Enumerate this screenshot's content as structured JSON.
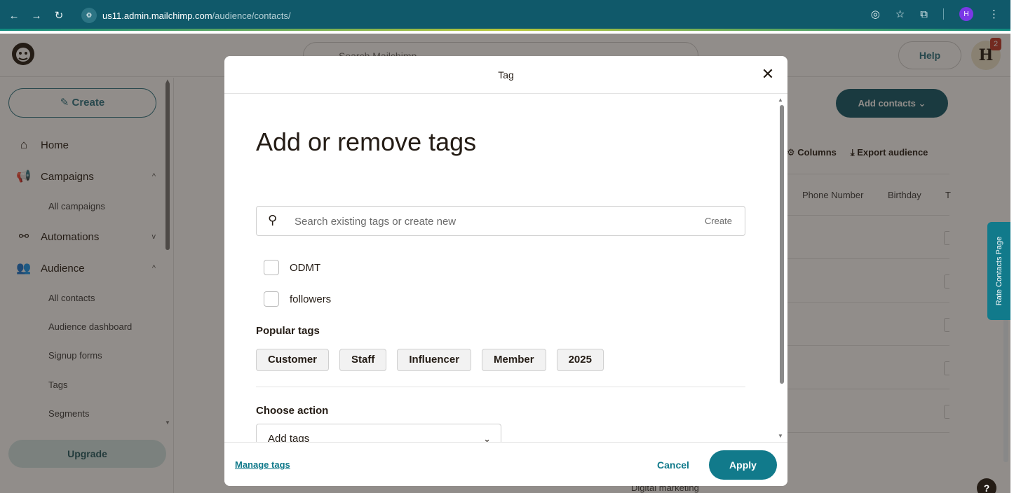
{
  "browser": {
    "url_host": "us11.admin.mailchimp.com",
    "url_path": "/audience/contacts/",
    "profile_initial": "H"
  },
  "header": {
    "search_placeholder": "Search Mailchimp",
    "help_label": "Help",
    "avatar_letter": "H",
    "notification_count": "2"
  },
  "sidebar": {
    "create_label": "Create",
    "items": [
      {
        "label": "Home",
        "icon": "home-icon"
      },
      {
        "label": "Campaigns",
        "icon": "megaphone-icon"
      },
      {
        "label": "Automations",
        "icon": "automation-icon"
      },
      {
        "label": "Audience",
        "icon": "audience-icon"
      }
    ],
    "campaigns_sub": [
      "All campaigns"
    ],
    "audience_sub": [
      "All contacts",
      "Audience dashboard",
      "Signup forms",
      "Tags",
      "Segments"
    ],
    "upgrade_label": "Upgrade"
  },
  "background": {
    "add_contacts_label": "Add contacts",
    "columns_label": "Columns",
    "export_label": "Export audience",
    "table_columns": [
      "Phone Number",
      "Birthday",
      "T"
    ],
    "footer_text": "Digital marketing",
    "rate_tab_label": "Rate Contacts Page",
    "help_float": "?"
  },
  "modal": {
    "title": "Tag",
    "heading": "Add or remove tags",
    "search_placeholder": "Search existing tags or create new",
    "create_label": "Create",
    "existing_tags": [
      "ODMT",
      "followers"
    ],
    "popular_label": "Popular tags",
    "popular_tags": [
      "Customer",
      "Staff",
      "Influencer",
      "Member",
      "2025"
    ],
    "choose_action_label": "Choose action",
    "action_value": "Add tags",
    "manage_tags_label": "Manage tags",
    "cancel_label": "Cancel",
    "apply_label": "Apply"
  },
  "colors": {
    "brand_teal": "#117a8b",
    "dark_teal": "#10596a",
    "text_dark": "#241c15"
  }
}
